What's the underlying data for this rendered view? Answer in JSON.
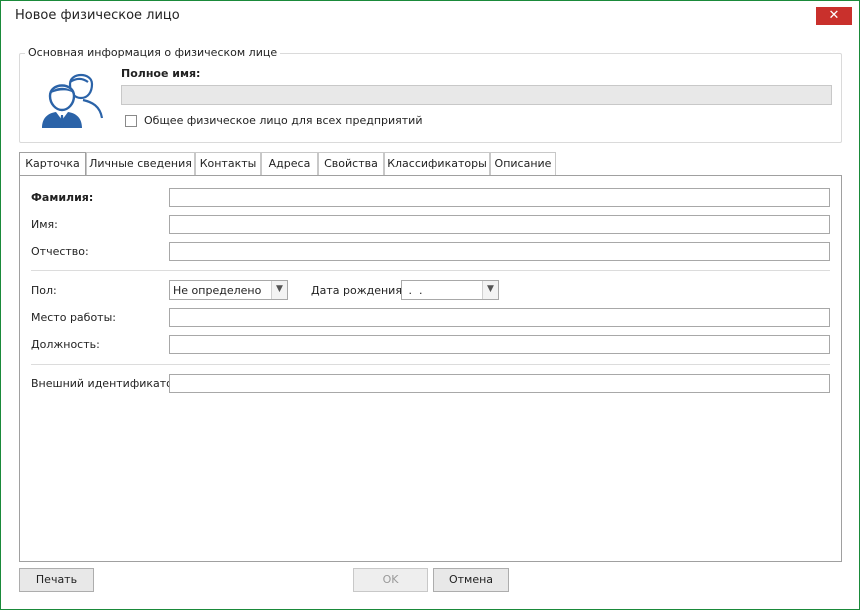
{
  "window": {
    "title": "Новое физическое лицо",
    "close_glyph": "✕"
  },
  "basic_info": {
    "legend": "Основная информация о физическом лице",
    "icon": "person-pair-icon",
    "fullname_label": "Полное имя:",
    "fullname_value": "",
    "shared_label": "Общее физическое лицо для всех предприятий",
    "shared_checked": false
  },
  "tabs": [
    {
      "label": "Карточка",
      "active": true
    },
    {
      "label": "Личные сведения",
      "active": false
    },
    {
      "label": "Контакты",
      "active": false
    },
    {
      "label": "Адреса",
      "active": false
    },
    {
      "label": "Свойства",
      "active": false
    },
    {
      "label": "Классификаторы",
      "active": false
    },
    {
      "label": "Описание",
      "active": false
    }
  ],
  "card": {
    "lastname_label": "Фамилия:",
    "lastname_value": "",
    "firstname_label": "Имя:",
    "firstname_value": "",
    "patronymic_label": "Отчество:",
    "patronymic_value": "",
    "gender_label": "Пол:",
    "gender_value": "Не определено",
    "birthdate_label": "Дата рождения:",
    "birthdate_value": " .  .",
    "workplace_label": "Место работы:",
    "workplace_value": "",
    "position_label": "Должность:",
    "position_value": "",
    "extid_label": "Внешний идентификатор:",
    "extid_value": ""
  },
  "buttons": {
    "print": "Печать",
    "ok": "OK",
    "cancel": "Отмена"
  },
  "colors": {
    "window_border": "#1a8a3a",
    "close_bg": "#c9302c",
    "icon_blue": "#2b63a8"
  }
}
